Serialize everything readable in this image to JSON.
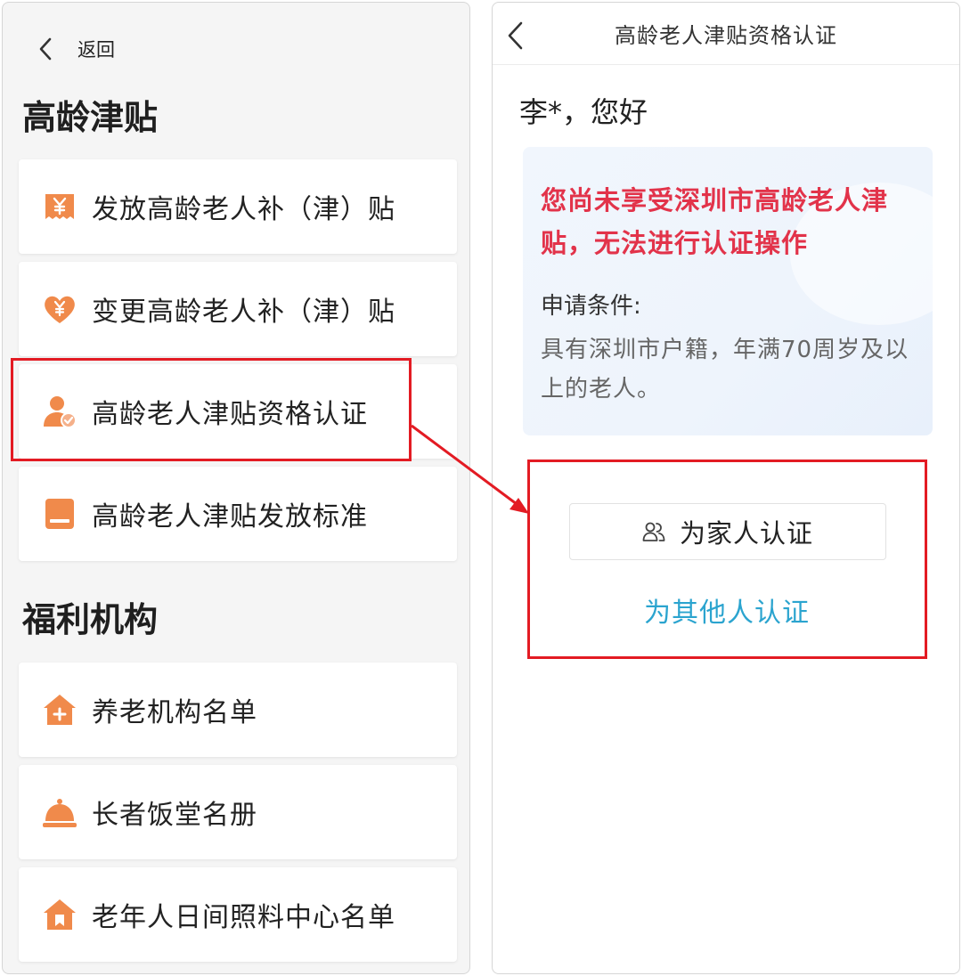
{
  "left": {
    "back_label": "返回",
    "section1_title": "高龄津贴",
    "section1_items": [
      {
        "label": "发放高龄老人补（津）贴",
        "icon": "yen-ticket-icon"
      },
      {
        "label": "变更高龄老人补（津）贴",
        "icon": "yen-heart-icon"
      },
      {
        "label": "高龄老人津贴资格认证",
        "icon": "user-verified-icon"
      },
      {
        "label": "高龄老人津贴发放标准",
        "icon": "book-icon"
      }
    ],
    "section2_title": "福利机构",
    "section2_items": [
      {
        "label": "养老机构名单",
        "icon": "house-plus-icon"
      },
      {
        "label": "长者饭堂名册",
        "icon": "food-cloche-icon"
      },
      {
        "label": "老年人日间照料中心名单",
        "icon": "house-bookmark-icon"
      }
    ]
  },
  "right": {
    "title": "高龄老人津贴资格认证",
    "greeting": "李*，您好",
    "warning": "您尚未享受深圳市高龄老人津贴，无法进行认证操作",
    "conditions_label": "申请条件:",
    "conditions_text": "具有深圳市户籍，年满70周岁及以上的老人。",
    "family_button": "为家人认证",
    "other_link": "为其他人认证"
  },
  "colors": {
    "accent_orange": "#f08a4b",
    "warning_red": "#e2334a",
    "link_blue": "#2ba4cf",
    "highlight_red": "#e31b23"
  }
}
